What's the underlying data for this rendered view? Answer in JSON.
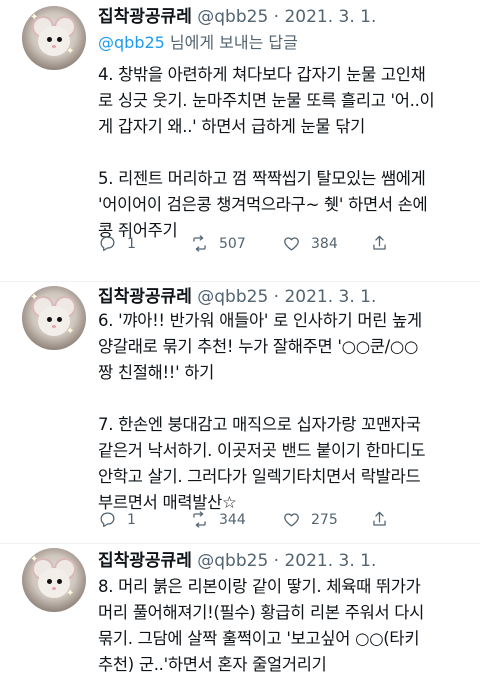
{
  "tweets": [
    {
      "name": "집착광공큐레",
      "handle": "@qbb25",
      "date": "2021. 3. 1.",
      "reply_handle": "@qbb25",
      "reply_suffix": " 님에게 보내는 답글",
      "paragraphs": [
        [
          "4. 창밖을 아련하게 쳐다보다 갑자기 눈물 고인채",
          "로 싱긋 웃기. 눈마주치면 눈물 또륵 흘리고 '어..이",
          "게 갑자기 왜..' 하면서 급하게 눈물 닦기"
        ],
        [
          "5. 리젠트 머리하고 껌 짝짝씹기 탈모있는 쌤에게",
          "'어이어이 검은콩 챙겨먹으라구~  췟' 하면서 손에",
          "콩 쥐어주기"
        ]
      ],
      "stats": {
        "replies": "1",
        "retweets": "507",
        "likes": "384"
      }
    },
    {
      "name": "집착광공큐레",
      "handle": "@qbb25",
      "date": "2021. 3. 1.",
      "paragraphs": [
        [
          "6. '꺄아!! 반가워 애들아' 로 인사하기 머린 높게",
          "양갈래로 묶기 추천!  누가 잘해주면 '○○쿤/○○",
          "짱 친절해!!' 하기"
        ],
        [
          "7. 한손엔 붕대감고 매직으로 십자가랑 꼬맨자국",
          "같은거 낙서하기. 이곳저곳 밴드 붙이기  한마디도",
          "안학고 살기. 그러다가  일렉기타치면서 락발라드",
          "부르면서 매력발산☆"
        ]
      ],
      "stats": {
        "replies": "1",
        "retweets": "344",
        "likes": "275"
      }
    },
    {
      "name": "집착광공큐레",
      "handle": "@qbb25",
      "date": "2021. 3. 1.",
      "paragraphs": [
        [
          "8. 머리 붉은 리본이랑 같이 땋기. 체육때 뛰가가",
          "머리 풀어해져기!(필수) 황급히 리본 주워서 다시",
          "묶기. 그담에 살짝 훌쩍이고 '보고싶어 ○○(타키",
          "추천) 군..'하면서 혼자 줄얼거리기"
        ]
      ]
    }
  ],
  "separator": " · ",
  "icons": [
    "reply-icon",
    "retweet-icon",
    "like-icon"
  ],
  "colors": {
    "link": "#1d9bf0",
    "muted": "#536471",
    "text": "#0f1419"
  }
}
